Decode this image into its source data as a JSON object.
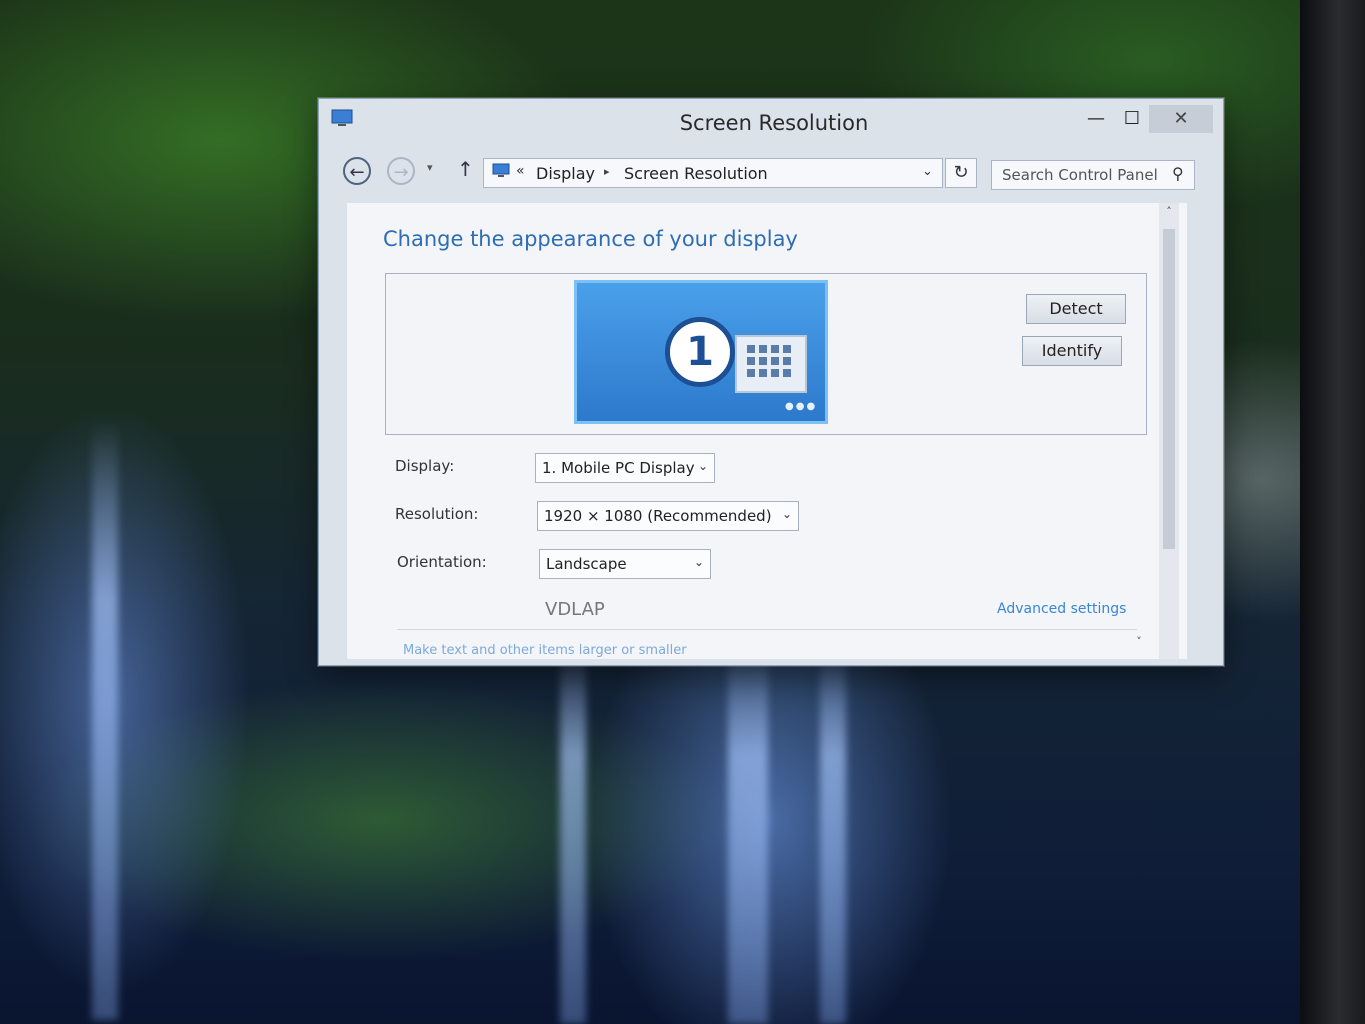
{
  "window": {
    "title": "Screen Resolution",
    "controls": {
      "minimize": "—",
      "maximize": "☐",
      "close": "✕"
    }
  },
  "nav": {
    "back": "←",
    "forward": "→",
    "history": "▾",
    "up": "↑",
    "breadcrumb_prefix": "«",
    "breadcrumb": [
      "Display",
      "Screen Resolution"
    ],
    "breadcrumb_separator": "▸",
    "address_dropdown": "⌄",
    "refresh": "↻",
    "search_placeholder": "Search Control Panel",
    "search_icon": "⚲"
  },
  "content": {
    "heading": "Change the appearance of your display",
    "monitor_number": "1",
    "monitor_dots": "●●●",
    "detect_label": "Detect",
    "identify_label": "Identify",
    "display": {
      "label": "Display:",
      "value": "1. Mobile PC Display"
    },
    "resolution": {
      "label": "Resolution:",
      "value": "1920 × 1080 (Recommended)"
    },
    "orientation": {
      "label": "Orientation:",
      "value": "Landscape"
    },
    "dropdown_arrow": "⌄",
    "machine_name": "VDLAP",
    "advanced_link": "Advanced settings",
    "partial_link": "Make text and other items larger or smaller"
  },
  "scroll": {
    "up": "˄",
    "down": "˅"
  },
  "colors": {
    "heading": "#2d6db3",
    "link": "#3a86d6",
    "monitor": "#2d79cc"
  }
}
